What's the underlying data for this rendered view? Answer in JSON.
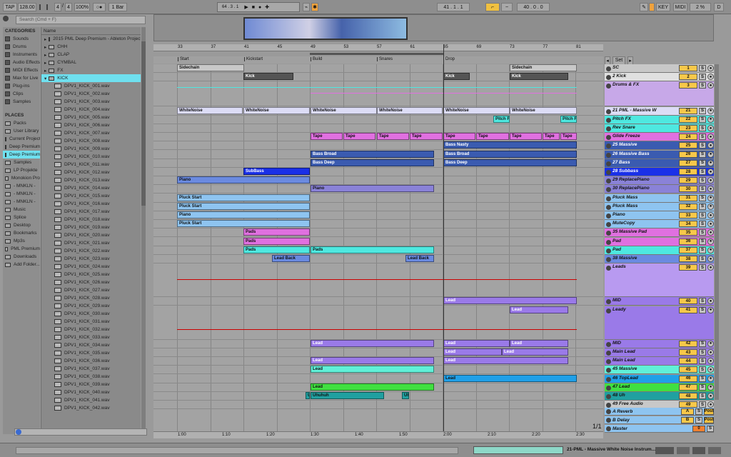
{
  "transport": {
    "tap": "TAP",
    "tempo": "128.00",
    "sig_num": "4",
    "sig_den": "4",
    "zoom": "100%",
    "quant": "1 Bar",
    "pos": "64 . 3 . 1",
    "loop_start": "41 . 1 . 1",
    "loop_len": "40 . 0 . 0",
    "key": "KEY",
    "midi": "MIDI",
    "cpu": "2 %",
    "io": "D"
  },
  "browser": {
    "search_placeholder": "Search (Cmd + F)",
    "categories_title": "CATEGORIES",
    "categories": [
      "Sounds",
      "Drums",
      "Instruments",
      "Audio Effects",
      "MIDI Effects",
      "Max for Live",
      "Plug-ins",
      "Clips",
      "Samples"
    ],
    "places_title": "PLACES",
    "places": [
      "Packs",
      "User Library",
      "Current Project",
      "Deep Premium",
      "Deep Premium",
      "Samples",
      "LP Projekte",
      "Monokion Pro",
      "- MNKLN -",
      "- MNKLN -",
      "- MNKLN -",
      "Music",
      "Splice",
      "Desktop",
      "Bookmarks",
      "Mp3s",
      "PML Premium",
      "Downloads",
      "Add Folder..."
    ],
    "name_header": "Name",
    "folders": [
      "2015 PML Deep Premium - Ableton Project",
      "CHH",
      "CLAP",
      "CYMBAL",
      "FX",
      "KICK"
    ],
    "files": [
      "DPV1_KICK_001.wav",
      "DPV1_KICK_002.wav",
      "DPV1_KICK_003.wav",
      "DPV1_KICK_004.wav",
      "DPV1_KICK_005.wav",
      "DPV1_KICK_006.wav",
      "DPV1_KICK_007.wav",
      "DPV1_KICK_008.wav",
      "DPV1_KICK_009.wav",
      "DPV1_KICK_010.wav",
      "DPV1_KICK_011.wav",
      "DPV1_KICK_012.wav",
      "DPV1_KICK_013.wav",
      "DPV1_KICK_014.wav",
      "DPV1_KICK_015.wav",
      "DPV1_KICK_016.wav",
      "DPV1_KICK_017.wav",
      "DPV1_KICK_018.wav",
      "DPV1_KICK_019.wav",
      "DPV1_KICK_020.wav",
      "DPV1_KICK_021.wav",
      "DPV1_KICK_022.wav",
      "DPV1_KICK_023.wav",
      "DPV1_KICK_024.wav",
      "DPV1_KICK_025.wav",
      "DPV1_KICK_026.wav",
      "DPV1_KICK_027.wav",
      "DPV1_KICK_028.wav",
      "DPV1_KICK_029.wav",
      "DPV1_KICK_030.wav",
      "DPV1_KICK_031.wav",
      "DPV1_KICK_032.wav",
      "DPV1_KICK_033.wav",
      "DPV1_KICK_034.wav",
      "DPV1_KICK_035.wav",
      "DPV1_KICK_036.wav",
      "DPV1_KICK_037.wav",
      "DPV1_KICK_038.wav",
      "DPV1_KICK_039.wav",
      "DPV1_KICK_040.wav",
      "DPV1_KICK_041.wav",
      "DPV1_KICK_042.wav"
    ]
  },
  "ruler": {
    "bars": [
      "33",
      "37",
      "41",
      "45",
      "49",
      "53",
      "57",
      "61",
      "65",
      "69",
      "73",
      "77",
      "81"
    ],
    "times": [
      "1:00",
      "1:10",
      "1:20",
      "1:30",
      "1:40",
      "1:50",
      "2:00",
      "2:10",
      "2:20",
      "2:30"
    ],
    "locators": [
      "Start",
      "Kickstart",
      "Build",
      "Snares",
      "Drop"
    ]
  },
  "tracks": [
    {
      "name": "SC",
      "num": "1",
      "color": "#c8c8c8",
      "h": 11
    },
    {
      "name": "2 Kick",
      "num": "2",
      "color": "#e0e0e0",
      "h": 11
    },
    {
      "name": "Drums & FX",
      "num": "3",
      "color": "#c7a8e8",
      "h": 34
    },
    {
      "name": "21 PML - Massive W",
      "num": "21",
      "color": "#dcdcf5",
      "h": 11
    },
    {
      "name": "Pitch FX",
      "num": "22",
      "color": "#4ee8e0",
      "h": 11
    },
    {
      "name": "Rev Snare",
      "num": "23",
      "color": "#4ee8e0",
      "h": 11
    },
    {
      "name": "Glide Freeze",
      "num": "24",
      "color": "#e070e0",
      "h": 11
    },
    {
      "name": "25 Massive",
      "num": "25",
      "color": "#3a5bb0",
      "h": 11
    },
    {
      "name": "26 Massive Bass",
      "num": "26",
      "color": "#3a5bb0",
      "h": 11
    },
    {
      "name": "27 Bass",
      "num": "27",
      "color": "#3a5bb0",
      "h": 11
    },
    {
      "name": "28 Subbass",
      "num": "28",
      "color": "#1a30e8",
      "h": 11
    },
    {
      "name": "29 ReplacePiano",
      "num": "29",
      "color": "#8a82d8",
      "h": 11
    },
    {
      "name": "30 ReplacePiano",
      "num": "30",
      "color": "#8a82d8",
      "h": 11
    },
    {
      "name": "Pluck Mass",
      "num": "31",
      "color": "#8ec4f0",
      "h": 11
    },
    {
      "name": "Pluck Mass",
      "num": "32",
      "color": "#8ec4f0",
      "h": 11
    },
    {
      "name": "Piano",
      "num": "33",
      "color": "#8ec4f0",
      "h": 11
    },
    {
      "name": "MuteCopy",
      "num": "34",
      "color": "#8ec4f0",
      "h": 11
    },
    {
      "name": "35 Massive Pad",
      "num": "35",
      "color": "#e070e0",
      "h": 11
    },
    {
      "name": "Pad",
      "num": "36",
      "color": "#e070e0",
      "h": 11
    },
    {
      "name": "Pad",
      "num": "37",
      "color": "#4ee8e0",
      "h": 11
    },
    {
      "name": "38 Massive",
      "num": "38",
      "color": "#6a8ae0",
      "h": 11
    },
    {
      "name": "Leads",
      "num": "39",
      "color": "#b89af0",
      "h": 46
    },
    {
      "name": "MID",
      "num": "40",
      "color": "#9a7ae8",
      "h": 11
    },
    {
      "name": "Leady",
      "num": "41",
      "color": "#9a7ae8",
      "h": 46
    },
    {
      "name": "MID",
      "num": "42",
      "color": "#9a7ae8",
      "h": 11
    },
    {
      "name": "Main Lead",
      "num": "43",
      "color": "#9a7ae8",
      "h": 11
    },
    {
      "name": "Main Lead",
      "num": "44",
      "color": "#9a7ae8",
      "h": 11
    },
    {
      "name": "45 Massive",
      "num": "45",
      "color": "#60f0d8",
      "h": 11
    },
    {
      "name": "46 TopLead",
      "num": "46",
      "color": "#20a0e8",
      "h": 11
    },
    {
      "name": "47 Lead",
      "num": "47",
      "color": "#40e040",
      "h": 11
    },
    {
      "name": "48 Uh",
      "num": "48",
      "color": "#20a0a0",
      "h": 11
    },
    {
      "name": "49 Free Audio",
      "num": "49",
      "color": "#c8c8c8",
      "h": 11
    }
  ],
  "returns": [
    {
      "name": "A Reverb",
      "num": "A",
      "btn": "Post",
      "color": "#8ec4f0"
    },
    {
      "name": "B Delay",
      "num": "B",
      "btn": "Post",
      "color": "#8ec4f0"
    },
    {
      "name": "Master",
      "num": "0",
      "btn": "",
      "color": "#8ec4f0"
    }
  ],
  "devices": {
    "speaker": "Speaker On",
    "mixer": "Mixer",
    "track_volume": "Track Volume",
    "vol_leads": "-2.6",
    "vol_leady": "-13.7",
    "inf": "-inf",
    "c": "C",
    "none": "None",
    "set": "Set",
    "counter": "1/1"
  },
  "clips": [
    {
      "t": "Sidechain",
      "row": 0,
      "s": 0,
      "e": 94,
      "c": "#c8c8c8"
    },
    {
      "t": "Sidechain",
      "row": 0,
      "s": 466,
      "e": 560,
      "c": "#c8c8c8"
    },
    {
      "t": "Kick",
      "row": 1,
      "s": 93,
      "e": 163,
      "c": "#555555",
      "fg": "#fff"
    },
    {
      "t": "Kick",
      "row": 1,
      "s": 373,
      "e": 410,
      "c": "#555555",
      "fg": "#fff"
    },
    {
      "t": "Kick",
      "row": 1,
      "s": 466,
      "e": 548,
      "c": "#555555",
      "fg": "#fff"
    },
    {
      "t": "WhiteNoise",
      "row": 3,
      "s": 0,
      "e": 92,
      "c": "#dcdcf5"
    },
    {
      "t": "WhiteNoise",
      "row": 3,
      "s": 93,
      "e": 186,
      "c": "#dcdcf5"
    },
    {
      "t": "WhiteNoise",
      "row": 3,
      "s": 187,
      "e": 280,
      "c": "#dcdcf5"
    },
    {
      "t": "WhiteNoise",
      "row": 3,
      "s": 280,
      "e": 372,
      "c": "#dcdcf5"
    },
    {
      "t": "WhiteNoise",
      "row": 3,
      "s": 373,
      "e": 466,
      "c": "#dcdcf5"
    },
    {
      "t": "WhiteNoise",
      "row": 3,
      "s": 466,
      "e": 560,
      "c": "#dcdcf5"
    },
    {
      "t": "Pitch FX",
      "row": 4,
      "s": 443,
      "e": 466,
      "c": "#4ee8e0"
    },
    {
      "t": "Pitch FX",
      "row": 4,
      "s": 537,
      "e": 560,
      "c": "#4ee8e0"
    },
    {
      "t": "Tape",
      "row": 6,
      "s": 187,
      "e": 232,
      "c": "#e070e0"
    },
    {
      "t": "Tape",
      "row": 6,
      "s": 233,
      "e": 278,
      "c": "#e070e0"
    },
    {
      "t": "Tape",
      "row": 6,
      "s": 280,
      "e": 325,
      "c": "#e070e0"
    },
    {
      "t": "Tape",
      "row": 6,
      "s": 326,
      "e": 372,
      "c": "#e070e0"
    },
    {
      "t": "Tape",
      "row": 6,
      "s": 373,
      "e": 418,
      "c": "#e070e0"
    },
    {
      "t": "Tape",
      "row": 6,
      "s": 419,
      "e": 465,
      "c": "#e070e0"
    },
    {
      "t": "Tape",
      "row": 6,
      "s": 466,
      "e": 511,
      "c": "#e070e0"
    },
    {
      "t": "Tape",
      "row": 6,
      "s": 512,
      "e": 536,
      "c": "#e070e0"
    },
    {
      "t": "Tape",
      "row": 6,
      "s": 537,
      "e": 560,
      "c": "#e070e0"
    },
    {
      "t": "Bass Nasty",
      "row": 7,
      "s": 373,
      "e": 560,
      "c": "#3a5bb0",
      "fg": "#fff"
    },
    {
      "t": "Bass Broad",
      "row": 8,
      "s": 187,
      "e": 360,
      "c": "#3a5bb0",
      "fg": "#fff"
    },
    {
      "t": "Bass Broad",
      "row": 8,
      "s": 373,
      "e": 560,
      "c": "#3a5bb0",
      "fg": "#fff"
    },
    {
      "t": "Bass Deep",
      "row": 9,
      "s": 187,
      "e": 360,
      "c": "#3a5bb0",
      "fg": "#fff"
    },
    {
      "t": "Bass Deep",
      "row": 9,
      "s": 373,
      "e": 560,
      "c": "#3a5bb0",
      "fg": "#fff"
    },
    {
      "t": "SubBass",
      "row": 10,
      "s": 93,
      "e": 186,
      "c": "#1a30e8",
      "fg": "#fff"
    },
    {
      "t": "Piano",
      "row": 11,
      "s": 0,
      "e": 186,
      "c": "#6a8ae0"
    },
    {
      "t": "Piano",
      "row": 12,
      "s": 187,
      "e": 360,
      "c": "#8a82d8"
    },
    {
      "t": "Pluck Start",
      "row": 13,
      "s": 0,
      "e": 186,
      "c": "#8ec4f0"
    },
    {
      "t": "Pluck Start",
      "row": 14,
      "s": 0,
      "e": 186,
      "c": "#8ec4f0"
    },
    {
      "t": "Piano",
      "row": 15,
      "s": 0,
      "e": 186,
      "c": "#8ec4f0"
    },
    {
      "t": "Pluck Start",
      "row": 16,
      "s": 0,
      "e": 186,
      "c": "#8ec4f0"
    },
    {
      "t": "Pads",
      "row": 17,
      "s": 93,
      "e": 186,
      "c": "#e070e0"
    },
    {
      "t": "Pads",
      "row": 18,
      "s": 93,
      "e": 186,
      "c": "#e070e0"
    },
    {
      "t": "Pads",
      "row": 19,
      "s": 93,
      "e": 186,
      "c": "#4ee8e0"
    },
    {
      "t": "Pads",
      "row": 19,
      "s": 187,
      "e": 360,
      "c": "#4ee8e0"
    },
    {
      "t": "Lead Back",
      "row": 20,
      "s": 133,
      "e": 186,
      "c": "#6a8ae0"
    },
    {
      "t": "Lead Back",
      "row": 20,
      "s": 320,
      "e": 360,
      "c": "#6a8ae0"
    },
    {
      "t": "Lead",
      "row": 22,
      "s": 373,
      "e": 560,
      "c": "#9a7ae8",
      "fg": "#fff"
    },
    {
      "t": "Lead",
      "row": 23,
      "s": 466,
      "e": 548,
      "c": "#9a7ae8",
      "fg": "#fff"
    },
    {
      "t": "Lead",
      "row": 24,
      "s": 187,
      "e": 360,
      "c": "#9a7ae8",
      "fg": "#fff"
    },
    {
      "t": "Lead",
      "row": 24,
      "s": 373,
      "e": 466,
      "c": "#9a7ae8",
      "fg": "#fff"
    },
    {
      "t": "Lead",
      "row": 24,
      "s": 466,
      "e": 548,
      "c": "#9a7ae8",
      "fg": "#fff"
    },
    {
      "t": "Lead",
      "row": 25,
      "s": 373,
      "e": 455,
      "c": "#9a7ae8",
      "fg": "#fff"
    },
    {
      "t": "Lead",
      "row": 25,
      "s": 455,
      "e": 548,
      "c": "#9a7ae8",
      "fg": "#fff"
    },
    {
      "t": "Lead",
      "row": 26,
      "s": 187,
      "e": 360,
      "c": "#9a7ae8",
      "fg": "#fff"
    },
    {
      "t": "Lead",
      "row": 26,
      "s": 373,
      "e": 548,
      "c": "#9a7ae8",
      "fg": "#fff"
    },
    {
      "t": "Lead",
      "row": 27,
      "s": 187,
      "e": 360,
      "c": "#60f0d8"
    },
    {
      "t": "Lead",
      "row": 28,
      "s": 373,
      "e": 560,
      "c": "#20a0e8"
    },
    {
      "t": "Lead",
      "row": 29,
      "s": 187,
      "e": 360,
      "c": "#40e040"
    },
    {
      "t": "Uh",
      "row": 30,
      "s": 180,
      "e": 186,
      "c": "#20a0a0"
    },
    {
      "t": "Uhuhuh",
      "row": 30,
      "s": 187,
      "e": 290,
      "c": "#20a0a0"
    },
    {
      "t": "Uh",
      "row": 30,
      "s": 315,
      "e": 325,
      "c": "#20a0a0"
    }
  ]
}
